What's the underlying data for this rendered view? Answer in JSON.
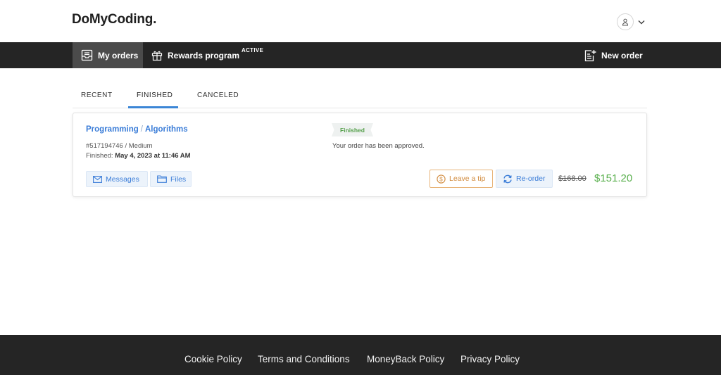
{
  "header": {
    "logo": "DoMyCoding.",
    "user_icon": "user-icon",
    "dropdown_icon": "chevron-down-icon"
  },
  "nav": {
    "my_orders": "My orders",
    "rewards": "Rewards program",
    "rewards_badge": "ACTIVE",
    "new_order": "New order"
  },
  "tabs": [
    {
      "label": "RECENT"
    },
    {
      "label": "FINISHED"
    },
    {
      "label": "CANCELED"
    }
  ],
  "order": {
    "category": "Programming",
    "subcategory": "Algorithms",
    "separator": "/",
    "id_text": "#517194746",
    "level": "Medium",
    "finished_label": "Finished:",
    "finished_date": "May 4, 2023 at 11:46 AM",
    "status": "Finished",
    "status_message": "Your order has been approved.",
    "messages_label": "Messages",
    "files_label": "Files",
    "tip_label": "Leave a tip",
    "reorder_label": "Re-order",
    "old_price": "$168.00",
    "new_price": "$151.20"
  },
  "footer": {
    "links": [
      "Cookie Policy",
      "Terms and Conditions",
      "MoneyBack Policy",
      "Privacy Policy"
    ]
  },
  "colors": {
    "accent": "#3b86d6",
    "status_green": "#57a14d",
    "tip_orange": "#d18a3c",
    "nav_bg": "#252525"
  }
}
